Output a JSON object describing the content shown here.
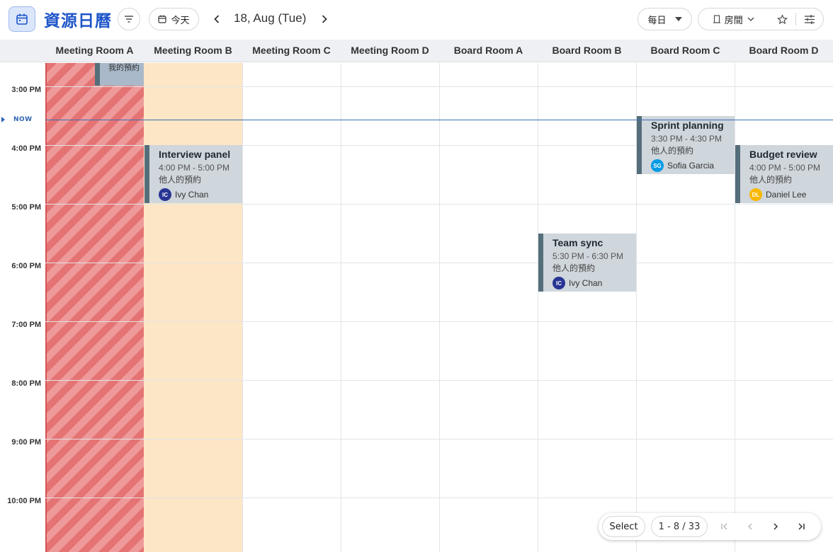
{
  "toolbar": {
    "title": "資源日曆",
    "today_label": "今天",
    "date": "18, Aug (Tue)",
    "view_mode": "每日",
    "resource_type": "房間"
  },
  "columns": [
    "Meeting Room A",
    "Meeting Room B",
    "Meeting Room C",
    "Meeting Room D",
    "Board Room A",
    "Board Room B",
    "Board Room C",
    "Board Room D"
  ],
  "time_slots": [
    "3:00 PM",
    "4:00 PM",
    "5:00 PM",
    "6:00 PM",
    "7:00 PM",
    "8:00 PM",
    "9:00 PM",
    "10:00 PM"
  ],
  "now_label": "NOW",
  "my_booking": {
    "label": "我的預約"
  },
  "events": [
    {
      "room": "Meeting Room B",
      "title": "Interview panel",
      "time": "4:00 PM - 5:00 PM",
      "owner": "他人的預約",
      "person": "Ivy Chan",
      "initials": "IC",
      "avatar_color": "#283593"
    },
    {
      "room": "Board Room C",
      "title": "Sprint planning",
      "time": "3:30 PM - 4:30 PM",
      "owner": "他人的預約",
      "person": "Sofia Garcia",
      "initials": "SG",
      "avatar_color": "#039be5"
    },
    {
      "room": "Board Room D",
      "title": "Budget review",
      "time": "4:00 PM - 5:00 PM",
      "owner": "他人的預約",
      "person": "Daniel Lee",
      "initials": "DL",
      "avatar_color": "#f9b800"
    },
    {
      "room": "Board Room B",
      "title": "Team sync",
      "time": "5:30 PM - 6:30 PM",
      "owner": "他人的預約",
      "person": "Ivy Chan",
      "initials": "IC",
      "avatar_color": "#283593"
    }
  ],
  "pagination": {
    "select_label": "Select",
    "range": "1 - 8 / 33"
  },
  "colors": {
    "accent": "#1f56c9",
    "blocked": "#e57373",
    "unavailable": "#fde6c5",
    "event": "#cfd6dc",
    "event_border": "#546e7a"
  }
}
